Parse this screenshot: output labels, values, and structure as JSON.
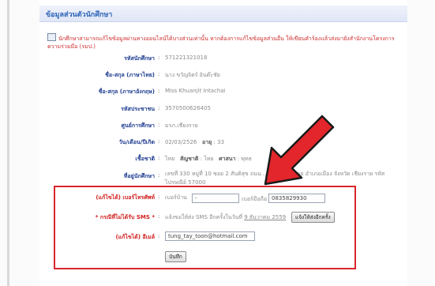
{
  "header": {
    "title": "ข้อมูลส่วนตัวนักศึกษา"
  },
  "notice": "นักศึกษาสามารถแก้ไขข้อมูลผ่านทางออนไลน์ได้บางส่วนเท่านั้น หากต้องการแก้ไขข้อมูลส่วนอื่น ให้เขียนคำร้องแล้วส่งมายังสำนักงานโครงการความร่วมมือ (รมป.)",
  "profile": {
    "student_id_label": "รหัสนักศึกษา",
    "student_id": "571221321018",
    "name_th_label": "ชื่อ-สกุล (ภาษาไทย)",
    "name_th": "นาง ขวัญจิตร์   อินต๊ะชัย",
    "name_en_label": "ชื่อ-สกุล (ภาษาอังกฤษ)",
    "name_en": "Miss Khuanjit   Intachai",
    "citizen_id_label": "รหัสประชาชน",
    "citizen_id": "3570500626405",
    "center_label": "ศูนย์การศึกษา",
    "center": "มรภ.เชียงราย",
    "birth_label": "วัน/เดือน/ปีเกิด",
    "birth": "02/03/2526",
    "age_label": "อายุ",
    "age": "33",
    "race_label": "เชื้อชาติ",
    "race": "ไทย",
    "nationality_label": "สัญชาติ",
    "nationality": "ไทย",
    "religion_label": "ศาสนา",
    "religion": "พุทธ",
    "address_label": "ที่อยู่นักศึกษา",
    "address": "เลขที่ 330   หมู่ที่ 10   ซอย 2 สันติสุข   ถนน ...   ตำบลสันทราย   อำเภอเมือง   จังหวัด เชียงราย   รหัสไปรษณีย์ 57000"
  },
  "edit": {
    "phone_label": "(แก้ไขได้) เบอร์โทรศัพท์",
    "home_phone_label": "เบอร์บ้าน",
    "home_phone": "-",
    "mobile_label": "เบอร์มือถือ",
    "mobile": "0835829930",
    "sms_label": "* กรณีที่ไม่ได้รับ SMS *",
    "sms_note": "แจ้งขอให้ส่ง SMS อีกครั้งในวันที่",
    "sms_date": "9 ธันวาคม 2559",
    "sms_button": "แจ้งให้ส่งอีกครั้ง",
    "email_label": "(แก้ไขได้) อีเมล์",
    "email": "tung_tay_toon@hotmail.com",
    "save_button": "บันทึก"
  },
  "colors": {
    "accent_red": "#d9262c",
    "label_blue": "#1f3d91",
    "header_blue": "#2d63b8"
  }
}
